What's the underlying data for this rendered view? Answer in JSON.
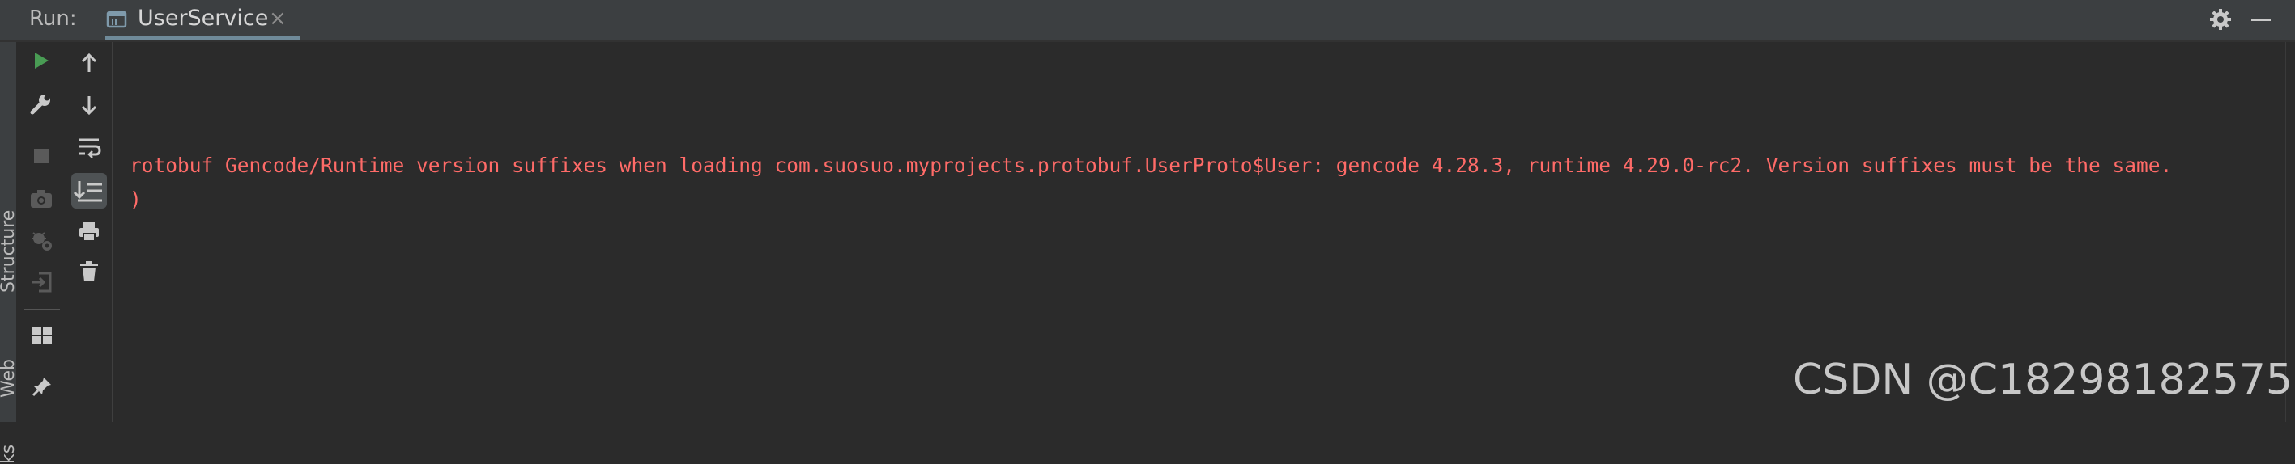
{
  "header": {
    "run_label": "Run:",
    "tab_label": "UserService",
    "tab_close": "×"
  },
  "side_panel": {
    "structure_label": "Structure",
    "web_label": "Web",
    "extra_label": "ks"
  },
  "console": {
    "lines": [
      "rotobuf Gencode/Runtime version suffixes when loading com.suosuo.myprojects.protobuf.UserProto$User: gencode 4.28.3, runtime 4.29.0-rc2. Version suffixes must be the same.",
      ")"
    ],
    "text_color": "#ff6b68"
  },
  "watermark": "CSDN @C18298182575",
  "icons": {
    "run": "play-icon",
    "rerun": "wrench-icon",
    "stop": "stop-icon",
    "screenshot": "camera-icon",
    "settings": "gear-icon",
    "minimize": "minimize-icon"
  },
  "colors": {
    "background": "#2b2b2b",
    "header": "#3c3f41",
    "accent_green": "#499c54",
    "error_text": "#ff6b68"
  }
}
